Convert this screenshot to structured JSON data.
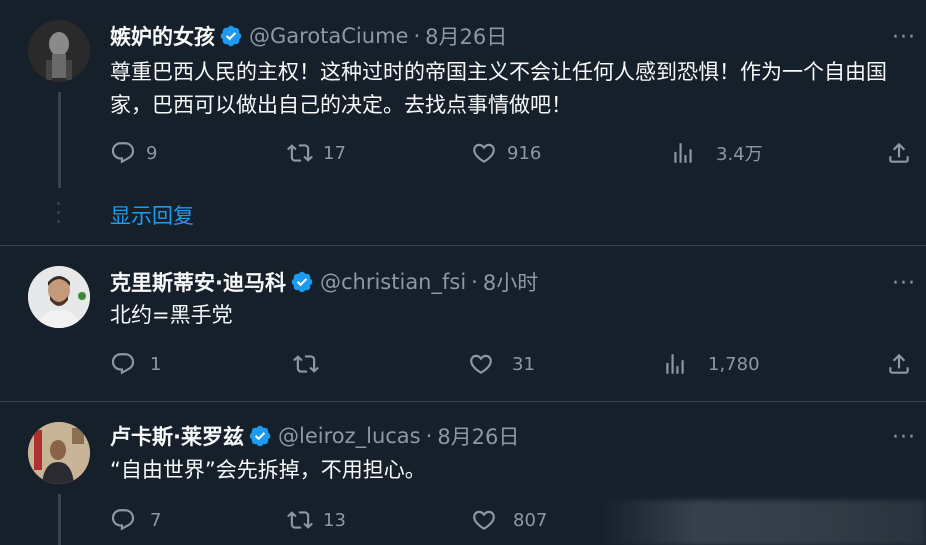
{
  "tweets": [
    {
      "name": "嫉妒的女孩",
      "handle": "@GarotaCiume",
      "dot": "·",
      "time": "8月26日",
      "text": "尊重巴西人民的主权！这种过时的帝国主义不会让任何人感到恐惧！作为一个自由国家，巴西可以做出自己的决定。去找点事情做吧！",
      "replies": "9",
      "retweets": "17",
      "likes": "916",
      "views": "3.4万",
      "show_replies": "显示回复"
    },
    {
      "name": "克里斯蒂安·迪马科",
      "handle": "@christian_fsi",
      "dot": "·",
      "time": "8小时",
      "text": "北约=黑手党",
      "replies": "1",
      "retweets": "",
      "likes": "31",
      "views": "1,780"
    },
    {
      "name": "卢卡斯·莱罗兹",
      "handle": "@leiroz_lucas",
      "dot": "·",
      "time": "8月26日",
      "text": "“自由世界”会先拆掉，不用担心。",
      "replies": "7",
      "retweets": "13",
      "likes": "807"
    }
  ],
  "more_label": "···",
  "colors": {
    "background": "#15202b",
    "accent": "#1d9bf0",
    "muted": "#8b98a5",
    "divider": "#38444d"
  },
  "icons": [
    "reply-icon",
    "retweet-icon",
    "like-icon",
    "views-icon",
    "share-icon",
    "verified-badge-icon",
    "more-icon"
  ]
}
